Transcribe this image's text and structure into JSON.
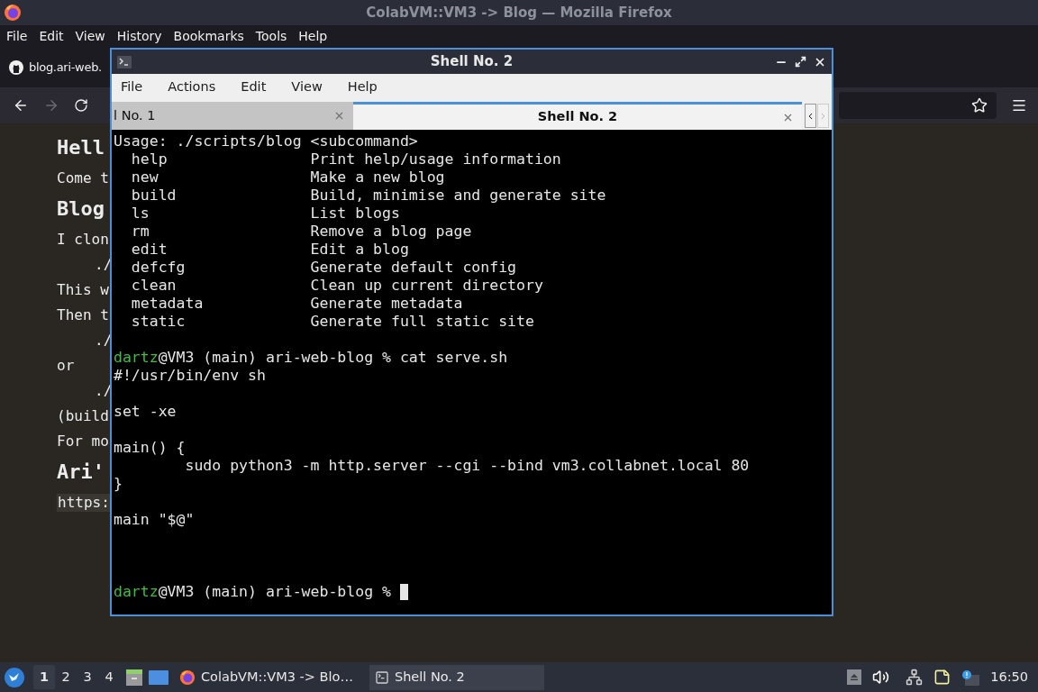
{
  "browser": {
    "title": "ColabVM::VM3 -> Blog — Mozilla Firefox",
    "menu": [
      "File",
      "Edit",
      "View",
      "History",
      "Bookmarks",
      "Tools",
      "Help"
    ],
    "tab": {
      "label": "blog.ari-web."
    },
    "nav": {
      "back_disabled": false,
      "forward_disabled": true
    },
    "content": [
      {
        "kind": "heading",
        "text": "Hell"
      },
      {
        "kind": "para",
        "text": "Come t"
      },
      {
        "kind": "heading",
        "text": "Blog"
      },
      {
        "kind": "para",
        "text": "I clon"
      },
      {
        "kind": "code",
        "text": "./"
      },
      {
        "kind": "para",
        "text": "This w"
      },
      {
        "kind": "para",
        "text": "Then t"
      },
      {
        "kind": "code",
        "text": "./"
      },
      {
        "kind": "para",
        "text": "or"
      },
      {
        "kind": "code",
        "text": "./"
      },
      {
        "kind": "para",
        "text": "(build"
      },
      {
        "kind": "para",
        "text": "For mo"
      },
      {
        "kind": "heading",
        "text": "Ari'"
      },
      {
        "kind": "link",
        "text": "https:"
      }
    ]
  },
  "terminal": {
    "title": "Shell No. 2",
    "menu": [
      "File",
      "Actions",
      "Edit",
      "View",
      "Help"
    ],
    "tabs": [
      {
        "label": "l No. 1",
        "selected": false
      },
      {
        "label": "Shell No. 2",
        "selected": true
      }
    ],
    "lines": [
      {
        "kind": "text",
        "text": "Usage: ./scripts/blog <subcommand>"
      },
      {
        "kind": "text",
        "text": "  help                Print help/usage information"
      },
      {
        "kind": "text",
        "text": "  new                 Make a new blog"
      },
      {
        "kind": "text",
        "text": "  build               Build, minimise and generate site"
      },
      {
        "kind": "text",
        "text": "  ls                  List blogs"
      },
      {
        "kind": "text",
        "text": "  rm                  Remove a blog page"
      },
      {
        "kind": "text",
        "text": "  edit                Edit a blog"
      },
      {
        "kind": "text",
        "text": "  defcfg              Generate default config"
      },
      {
        "kind": "text",
        "text": "  clean               Clean up current directory"
      },
      {
        "kind": "text",
        "text": "  metadata            Generate metadata"
      },
      {
        "kind": "text",
        "text": "  static              Generate full static site"
      },
      {
        "kind": "blank"
      },
      {
        "kind": "prompt",
        "user": "dartz",
        "text": "@VM3 (main) ari-web-blog % cat serve.sh",
        "cursor": false
      },
      {
        "kind": "text",
        "text": "#!/usr/bin/env sh"
      },
      {
        "kind": "blank"
      },
      {
        "kind": "text",
        "text": "set -xe"
      },
      {
        "kind": "blank"
      },
      {
        "kind": "text",
        "text": "main() {"
      },
      {
        "kind": "text",
        "text": "        sudo python3 -m http.server --cgi --bind vm3.collabnet.local 80"
      },
      {
        "kind": "text",
        "text": "}"
      },
      {
        "kind": "blank"
      },
      {
        "kind": "text",
        "text": "main \"$@\""
      },
      {
        "kind": "blank"
      },
      {
        "kind": "blank"
      },
      {
        "kind": "blank"
      },
      {
        "kind": "prompt",
        "user": "dartz",
        "text": "@VM3 (main) ari-web-blog % ",
        "cursor": true
      }
    ]
  },
  "taskbar": {
    "workspaces": [
      {
        "label": "1",
        "selected": true
      },
      {
        "label": "2",
        "selected": false
      },
      {
        "label": "3",
        "selected": false
      },
      {
        "label": "4",
        "selected": false
      }
    ],
    "tasks": [
      {
        "kind": "firefox",
        "label": "ColabVM::VM3 -> Blo…",
        "selected": false
      },
      {
        "kind": "terminal",
        "label": "Shell No. 2",
        "selected": true
      }
    ],
    "clock": "16:50"
  }
}
